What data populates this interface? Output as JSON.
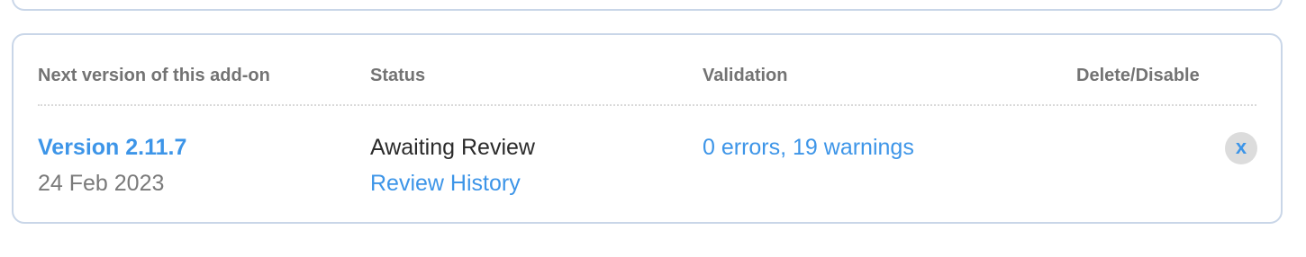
{
  "table": {
    "headers": {
      "version": "Next version of this add-on",
      "status": "Status",
      "validation": "Validation",
      "delete": "Delete/Disable"
    },
    "rows": [
      {
        "version_label": "Version 2.11.7",
        "date": "24 Feb 2023",
        "status": "Awaiting Review",
        "review_history": "Review History",
        "validation": "0 errors, 19 warnings",
        "delete_symbol": "x"
      }
    ]
  },
  "colors": {
    "link": "#3d95e8",
    "border": "#c9d6e8",
    "header_text": "#737373",
    "delete_button_bg": "#dcdcdc"
  },
  "icons": {
    "delete": "close-icon"
  }
}
